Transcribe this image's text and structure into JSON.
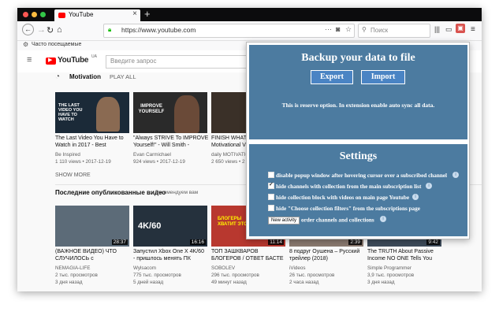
{
  "browser": {
    "tab_title": "YouTube",
    "new_tab": "+",
    "url": "https://www.youtube.com",
    "search_placeholder": "Поиск",
    "bookmark": "Часто посещаемые"
  },
  "youtube": {
    "logo": "YouTube",
    "logo_region": "UA",
    "search_placeholder": "Введите запрос",
    "section1_title": "Motivation",
    "play_all": "PLAY ALL",
    "show_more": "SHOW MORE",
    "section2_title": "Последние опубликованные видео",
    "section2_sub": "Рекомендуем вам",
    "row1": [
      {
        "title1": "The Last Video You Have to",
        "title2": "Watch in 2017 - Best",
        "channel": "Be Inspired",
        "meta": "1 110 views • 2017-12-19",
        "thumb_color": "#1b2a38"
      },
      {
        "title1": "\"Always STRIVE To IMPROVE",
        "title2": "Yourself!\" - Will Smith -",
        "channel": "Evan Carmichael",
        "meta": "924 views • 2017-12-19",
        "thumb_color": "#2a2a2a"
      },
      {
        "title1": "FINISH WHAT Y",
        "title2": "Motivational Vi",
        "channel": "daily MOTIVATIO",
        "meta": "2 650 views • 2",
        "thumb_color": "#3a3028"
      }
    ],
    "thumb_overlays": [
      "THE LAST VIDEO YOU HAVE TO WATCH",
      "IMPROVE YOURSELF",
      ""
    ],
    "row2": [
      {
        "title1": "(ВАЖНОЕ ВИДЕО) ЧТО",
        "title2": "СЛУЧИЛОСЬ с",
        "channel": "NEMAGIA-LIFE",
        "meta1": "2 тыс. просмотров",
        "meta2": "3 дня назад",
        "duration": "28:37",
        "thumb_color": "#5c6b78"
      },
      {
        "title1": "Запустил Xbox One X 4K/60",
        "title2": "- пришлось менять ПК",
        "channel": "Wylsacom",
        "meta1": "775 тыс. просмотров",
        "meta2": "5 дней назад",
        "duration": "16:16",
        "thumb_color": "#25313d"
      },
      {
        "title1": "ТОП ЗАШКВАРОВ",
        "title2": "БЛОГЕРОВ / ОТВЕТ БАСТЕ",
        "channel": "SOBOLEV",
        "meta1": "296 тыс. просмотров",
        "meta2": "49 минут назад",
        "duration": "11:14",
        "thumb_color": "#b8382f"
      },
      {
        "title1": "8 подруг Оушена – Русский",
        "title2": "трейлер (2018)",
        "channel": "iVideos",
        "meta1": "26 тыс. просмотров",
        "meta2": "2 часа назад",
        "duration": "2:39",
        "thumb_color": "#8a7a70"
      },
      {
        "title1": "The TRUTH About Passive",
        "title2": "Income NO ONE Tells You",
        "channel": "Simple Programmer",
        "meta1": "3,9 тыс. просмотров",
        "meta2": "3 дня назад",
        "duration": "9:42",
        "thumb_color": "#3d4b5a"
      }
    ],
    "thumb2_overlay": "4K/60",
    "thumb3_overlay": "БЛОГЕРЫ ХВАТИТ ЭТО"
  },
  "popup": {
    "backup_title": "Backup your data to file",
    "export_label": "Export",
    "import_label": "Import",
    "reserve_note": "This is reserve option. In extension enable auto sync all data.",
    "settings_title": "Settings",
    "options": [
      {
        "label": "disable popup window after hovering cursor over a subscribed channel",
        "checked": false
      },
      {
        "label": "hide channels with collection from the main subscription list",
        "checked": true
      },
      {
        "label": "hide collection block with videos on main page Youtube",
        "checked": false
      },
      {
        "label": "hide \"Choose collection filters\" from the subscriptions page",
        "checked": false
      }
    ],
    "order_select": "New activity",
    "order_label": "order channels and collections",
    "info_glyph": "i"
  },
  "colors": {
    "panel": "#4c7ba0",
    "button": "#4a84c4",
    "youtube_red": "#ff0000"
  }
}
